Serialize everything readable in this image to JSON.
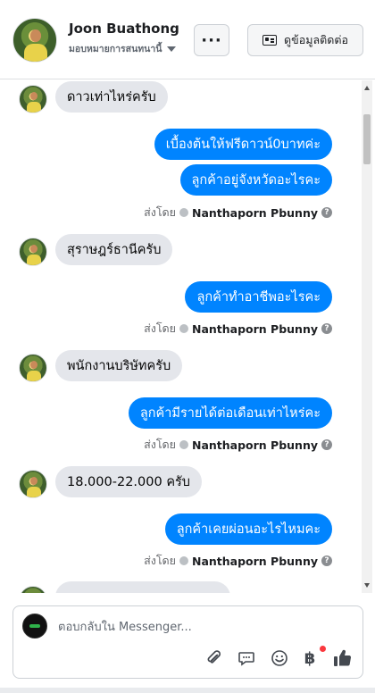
{
  "header": {
    "contact_name": "Joon Buathong",
    "assign_label": "มอบหมายการสนทนานี้",
    "more_label": "···",
    "info_button_label": "ดูข้อมูลติดต่อ"
  },
  "conversation": {
    "messages": [
      {
        "from": "customer",
        "text": "ดาวเท่าไหร่ครับ"
      },
      {
        "from": "page",
        "text": "เบื้องต้นให้ฟรีดาวน์0บาทค่ะ"
      },
      {
        "from": "page",
        "text": "ลูกค้าอยู่จังหวัดอะไรคะ"
      },
      {
        "from": "customer",
        "text": "สุราษฎร์ธานีครับ"
      },
      {
        "from": "page",
        "text": "ลูกค้าทำอาชีพอะไรคะ"
      },
      {
        "from": "customer",
        "text": "พนักงานบริษัทครับ"
      },
      {
        "from": "page",
        "text": "ลูกค้ามีรายได้ต่อเดือนเท่าไหร่คะ"
      },
      {
        "from": "customer",
        "text": "18.000-22.000 ครับ"
      },
      {
        "from": "page",
        "text": "ลูกค้าเคยผ่อนอะไรไหมคะ"
      }
    ],
    "sent_by_prefix": "ส่งโดย",
    "sent_by_name": "Nanthaporn Pbunny"
  },
  "composer": {
    "placeholder": "ตอบกลับใน Messenger...",
    "currency_symbol": "฿"
  }
}
